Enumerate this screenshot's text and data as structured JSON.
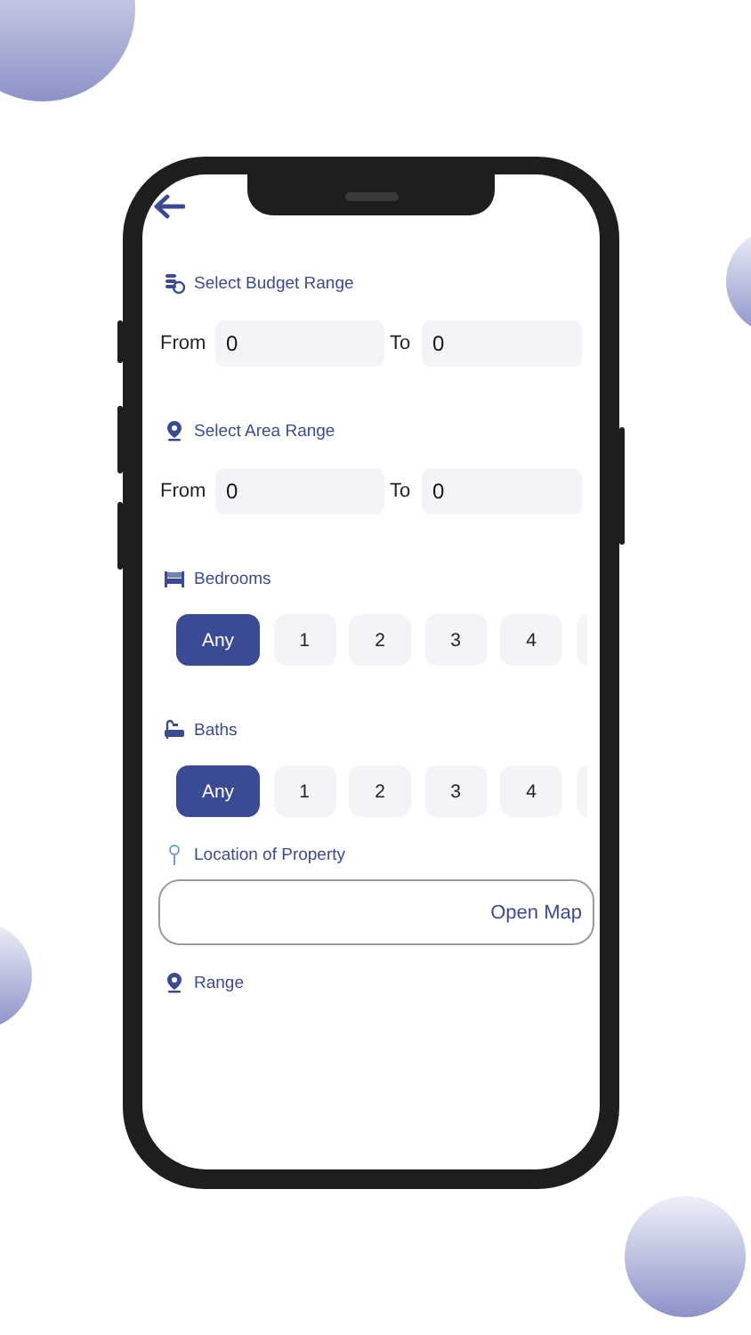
{
  "sections": [
    {
      "kind": "range",
      "title": "Select Budget Range",
      "from_label": "From",
      "from_value": "0",
      "to_label": "To",
      "to_value": "0"
    },
    {
      "kind": "range",
      "title": "Select Area Range",
      "from_label": "From",
      "from_value": "0",
      "to_label": "To",
      "to_value": "0"
    },
    {
      "kind": "chips",
      "title": "Bedrooms",
      "more": true,
      "options": [
        {
          "label": "Any",
          "selected": true
        },
        {
          "label": "1",
          "selected": false
        },
        {
          "label": "2",
          "selected": false
        },
        {
          "label": "3",
          "selected": false
        },
        {
          "label": "4",
          "selected": false
        }
      ]
    },
    {
      "kind": "chips",
      "title": "Baths",
      "more": true,
      "options": [
        {
          "label": "Any",
          "selected": true
        },
        {
          "label": "1",
          "selected": false
        },
        {
          "label": "2",
          "selected": false
        },
        {
          "label": "3",
          "selected": false
        },
        {
          "label": "4",
          "selected": false
        }
      ]
    },
    {
      "kind": "map",
      "title": "Location of Property",
      "button": "Open Map"
    },
    {
      "kind": "heading",
      "title": "Range"
    }
  ]
}
